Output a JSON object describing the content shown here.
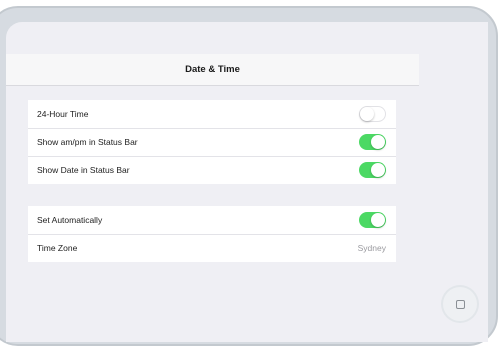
{
  "navbar": {
    "title": "Date & Time"
  },
  "settings_group_1": {
    "rows": [
      {
        "label": "24-Hour Time",
        "toggle": "off"
      },
      {
        "label": "Show am/pm in Status Bar",
        "toggle": "on"
      },
      {
        "label": "Show Date in Status Bar",
        "toggle": "on"
      }
    ]
  },
  "settings_group_2": {
    "rows": [
      {
        "label": "Set Automatically",
        "toggle": "on"
      },
      {
        "label": "Time Zone",
        "value": "Sydney"
      }
    ]
  },
  "colors": {
    "toggle_on": "#4cd964",
    "background": "#efeff4"
  },
  "icons": {
    "home_button": "home-button-icon"
  }
}
